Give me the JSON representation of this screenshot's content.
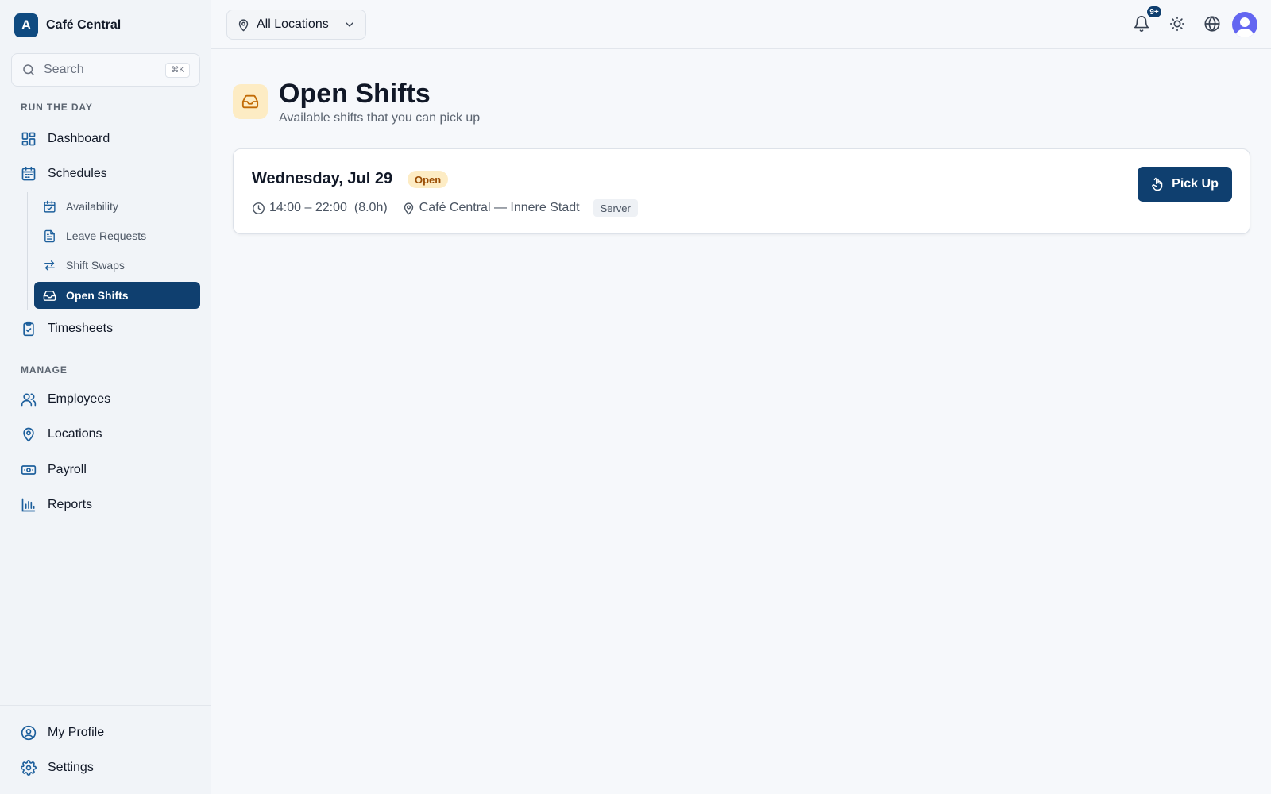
{
  "brand": {
    "logo_letter": "A",
    "name": "Café Central"
  },
  "search": {
    "placeholder": "Search",
    "shortcut": "⌘K"
  },
  "sidebar": {
    "sections": [
      {
        "label": "RUN THE DAY"
      },
      {
        "label": "MANAGE"
      }
    ],
    "items": [
      {
        "label": "Dashboard",
        "icon": "dashboard-icon"
      },
      {
        "label": "Schedules",
        "icon": "calendar-icon"
      },
      {
        "label": "Timesheets",
        "icon": "clipboard-check-icon"
      },
      {
        "label": "Employees",
        "icon": "users-icon"
      },
      {
        "label": "Locations",
        "icon": "map-pin-icon"
      },
      {
        "label": "Payroll",
        "icon": "banknote-icon"
      },
      {
        "label": "Reports",
        "icon": "bar-chart-icon"
      }
    ],
    "schedule_subitems": [
      {
        "label": "Availability",
        "icon": "calendar-check-icon"
      },
      {
        "label": "Leave Requests",
        "icon": "file-text-icon"
      },
      {
        "label": "Shift Swaps",
        "icon": "swap-arrows-icon"
      },
      {
        "label": "Open Shifts",
        "icon": "inbox-icon",
        "active": true
      }
    ],
    "footer": [
      {
        "label": "My Profile",
        "icon": "user-circle-icon"
      },
      {
        "label": "Settings",
        "icon": "gear-icon"
      }
    ]
  },
  "topbar": {
    "location_select": "All Locations",
    "notifications_badge": "9+"
  },
  "page": {
    "title": "Open Shifts",
    "subtitle": "Available shifts that you can pick up"
  },
  "shifts": [
    {
      "date": "Wednesday, Jul 29",
      "status": "Open",
      "time": "14:00 – 22:00",
      "duration": "(8.0h)",
      "location": "Café Central — Innere Stadt",
      "role": "Server",
      "action": "Pick Up"
    }
  ],
  "colors": {
    "primary": "#0f3f6f",
    "accent_icon": "#1d5f9c",
    "status_open_bg": "#fdecc4",
    "status_open_text": "#9a4d05",
    "avatar": "#6366f1"
  }
}
